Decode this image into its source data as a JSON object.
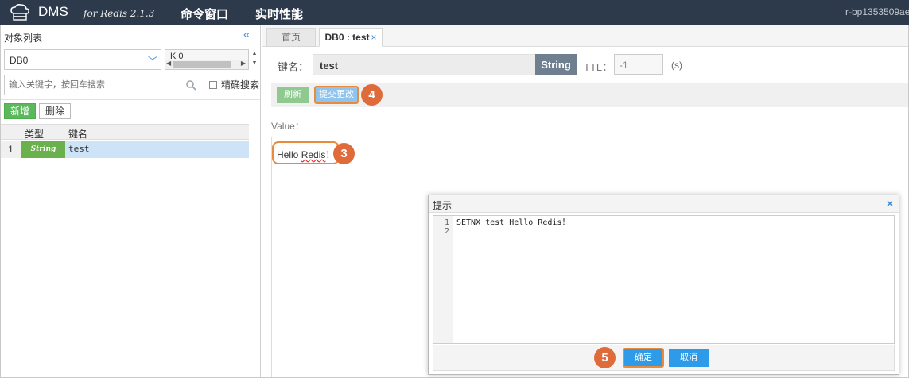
{
  "topbar": {
    "brand": "DMS",
    "brand_sub": "for Redis 2.1.3",
    "nav": [
      "命令窗口",
      "实时性能"
    ],
    "instance_id": "r-bp1353509ae"
  },
  "left": {
    "title": "对象列表",
    "collapse_icon": "double-chevron-left-icon",
    "db_select": "DB0",
    "key_value": "K    0",
    "search_placeholder": "输入关键字，按回车搜索",
    "exact_search": "精确搜索",
    "buttons": {
      "new": "新增",
      "delete": "删除"
    },
    "grid": {
      "columns": [
        "类型",
        "键名"
      ],
      "rows": [
        {
          "num": "1",
          "type": "String",
          "key": "test"
        }
      ]
    }
  },
  "tabs": [
    "首页",
    "DB0 : test"
  ],
  "tab_close": "×",
  "editor": {
    "key_label": "键名：",
    "key_name": "test",
    "type": "String",
    "ttl_label": "TTL：",
    "ttl_value": "-1",
    "ttl_unit": "(s)",
    "refresh": "刷新",
    "submit": "提交更改",
    "value_label": "Value：",
    "value_prefix": "Hello ",
    "value_word": "Redis",
    "value_suffix": "！"
  },
  "steps": {
    "s3": "3",
    "s4": "4",
    "s5": "5"
  },
  "dialog": {
    "title": "提示",
    "close": "×",
    "lines": [
      "1",
      "2"
    ],
    "code": "SETNX test Hello Redis！",
    "ok": "确定",
    "cancel": "取消"
  },
  "colors": {
    "topbar": "#2d3a4b",
    "accent": "#2d9be8",
    "highlight": "#e88b3c",
    "step": "#e06b3a",
    "string_badge": "#6ab04c"
  }
}
